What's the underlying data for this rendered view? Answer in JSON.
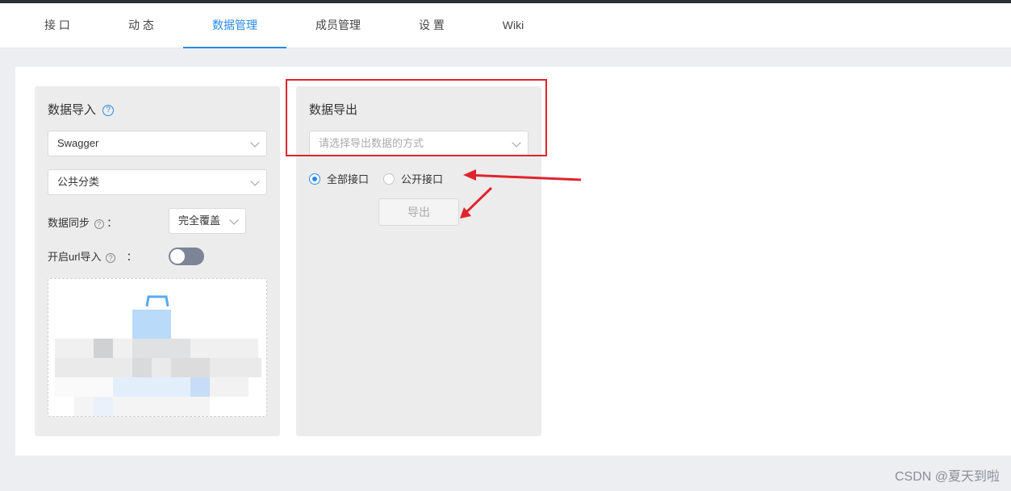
{
  "tabs": [
    {
      "label": "接 口"
    },
    {
      "label": "动 态"
    },
    {
      "label": "数据管理"
    },
    {
      "label": "成员管理"
    },
    {
      "label": "设 置"
    },
    {
      "label": "Wiki"
    }
  ],
  "active_tab": "数据管理",
  "accent_color": "#2a8ae6",
  "import_panel": {
    "title": "数据导入",
    "help_icon": "?",
    "format_select": "Swagger",
    "category_select": "公共分类",
    "sync_label": "数据同步",
    "sync_colon": "：",
    "sync_select": "完全覆盖",
    "url_import_label": "开启url导入",
    "url_import_colon": "：",
    "url_import_enabled": false
  },
  "export_panel": {
    "title": "数据导出",
    "method_placeholder": "请选择导出数据的方式",
    "radio_all": "全部接口",
    "radio_public": "公开接口",
    "radio_selected": "全部接口",
    "export_button": "导出"
  },
  "annotation_color": "#e0242d",
  "watermark": "CSDN @夏天到啦"
}
